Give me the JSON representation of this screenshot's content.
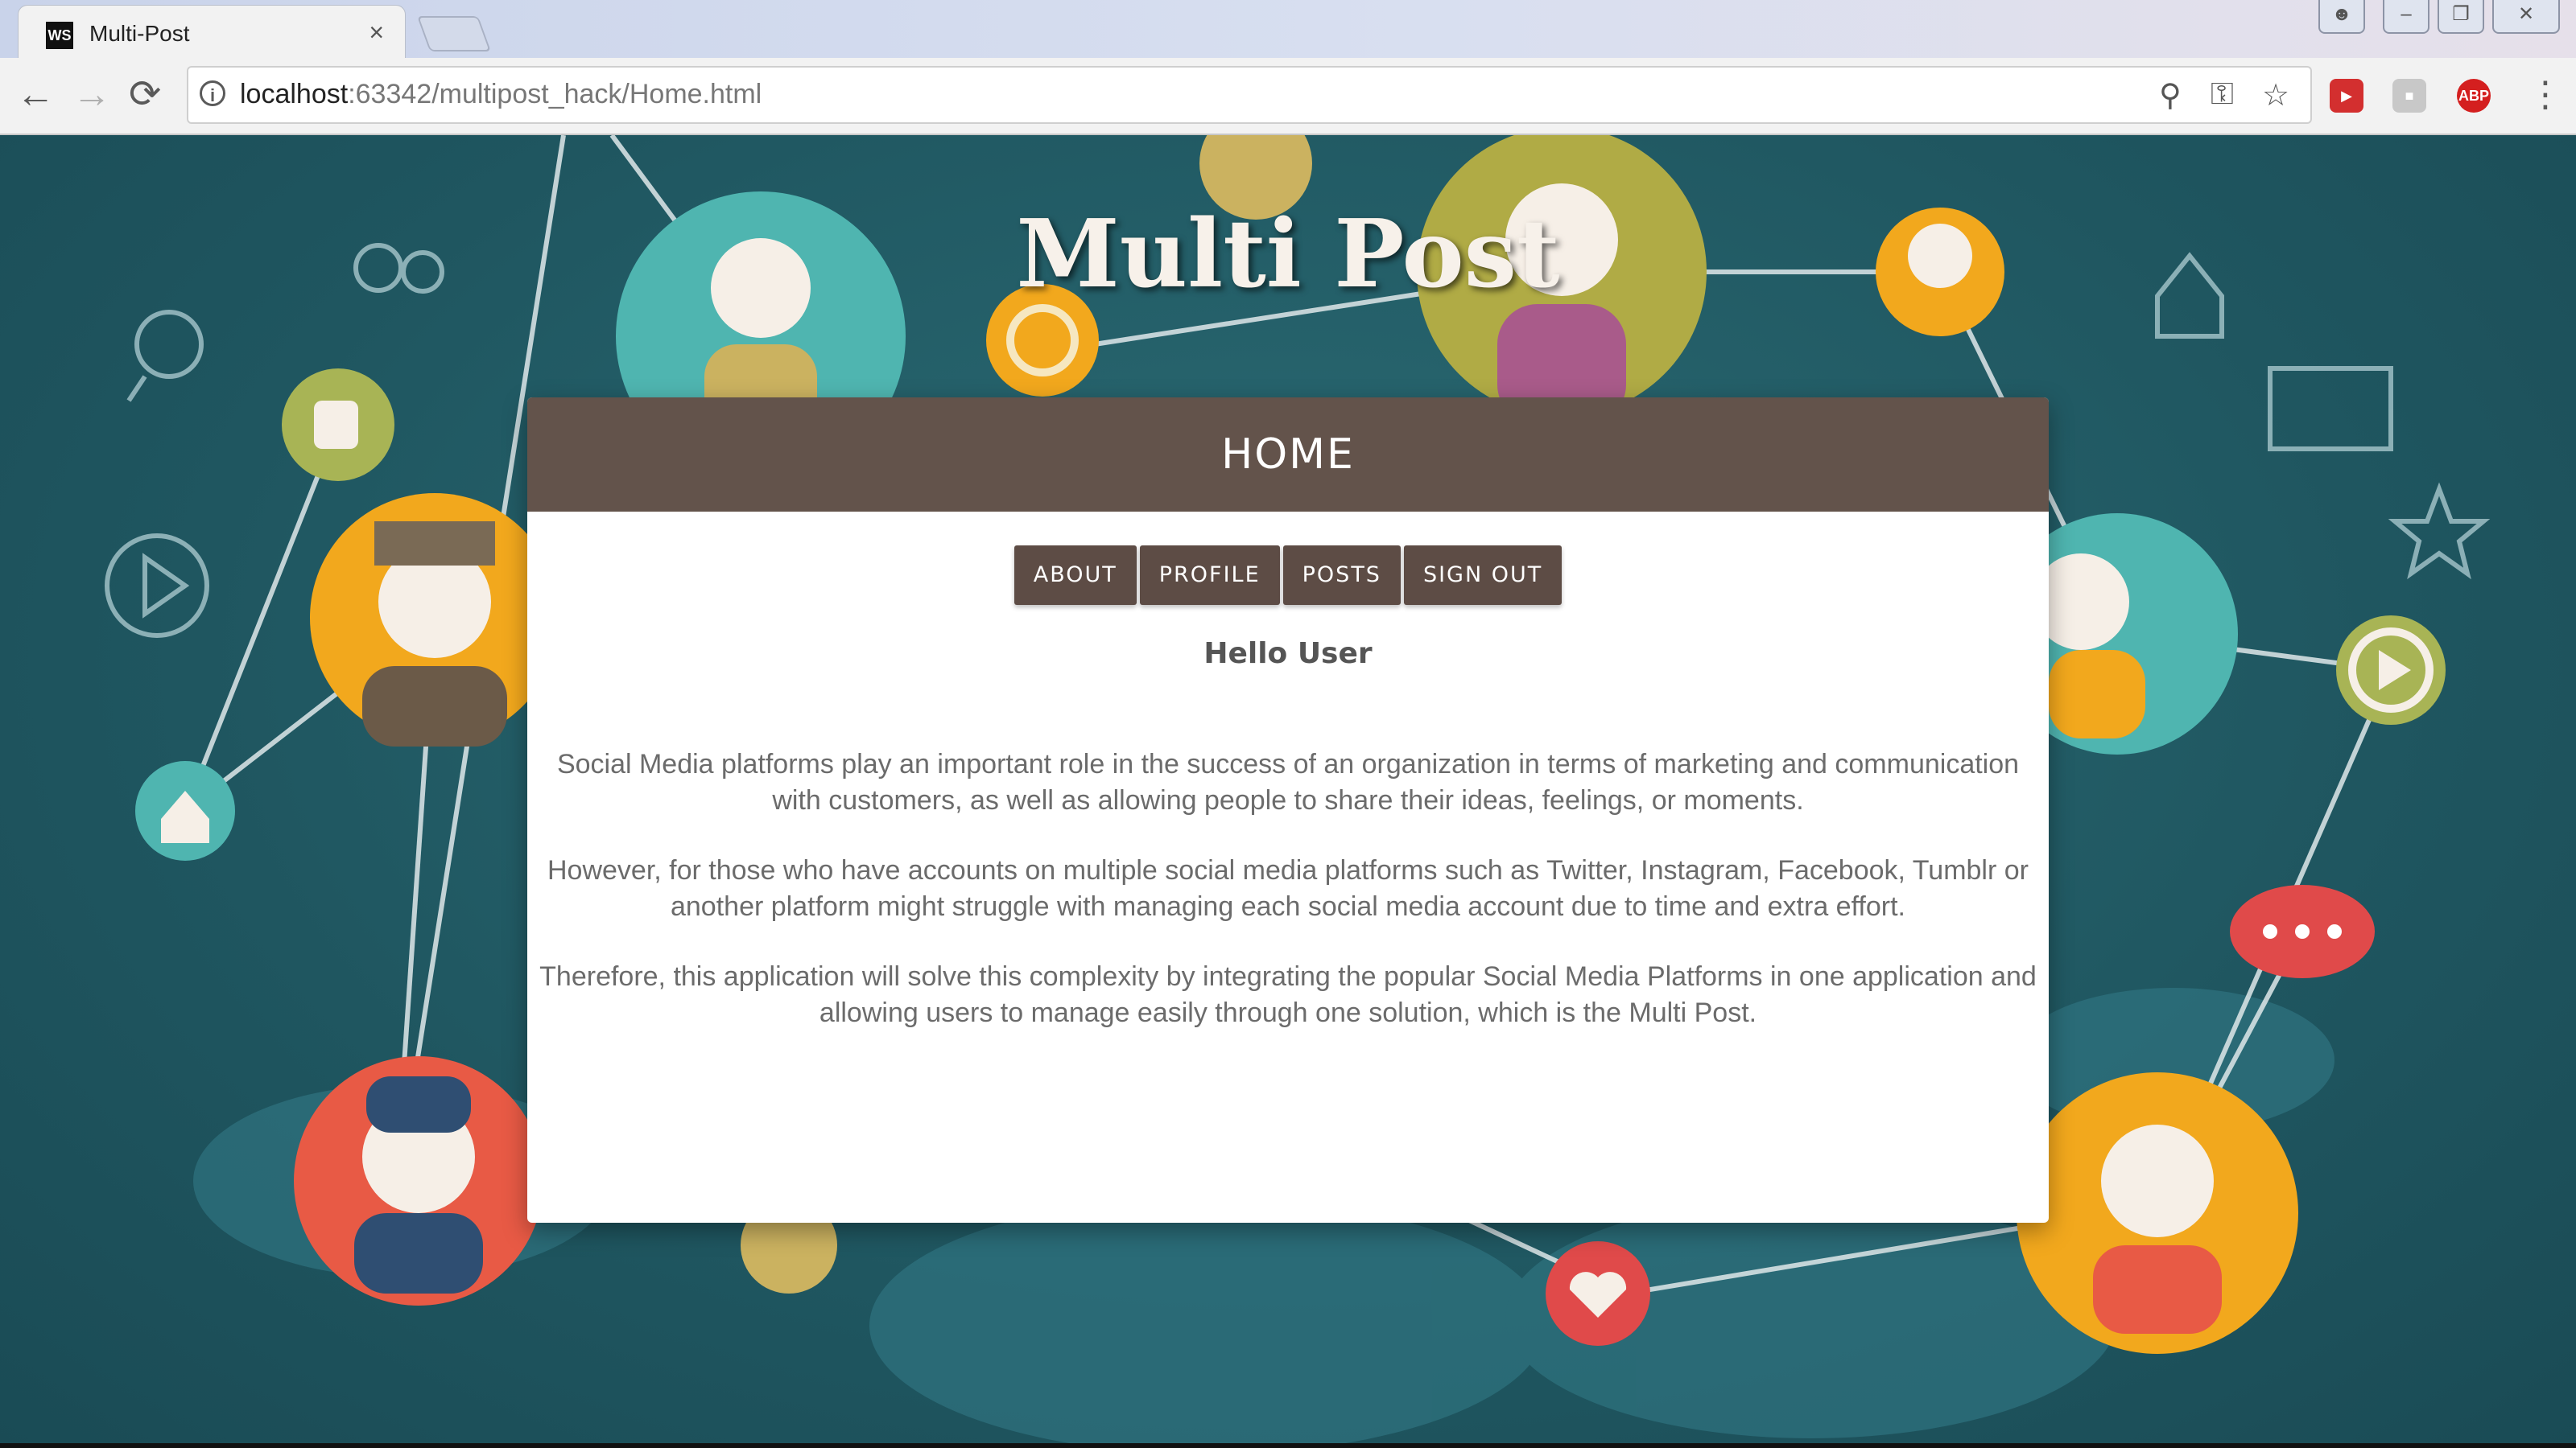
{
  "browser": {
    "tab_title": "Multi-Post",
    "tab_favicon": "WS",
    "tab_close": "×",
    "url_host": "localhost",
    "url_rest": ":63342/multipost_hack/Home.html",
    "back_icon": "←",
    "forward_icon": "→",
    "reload_icon": "⟳",
    "ext_abp": "ABP"
  },
  "page": {
    "site_title": "Multi Post",
    "card_title": "HOME",
    "nav_buttons": [
      "ABOUT",
      "PROFILE",
      "POSTS",
      "SIGN OUT"
    ],
    "greeting": "Hello User",
    "paragraphs": [
      "Social Media platforms play an important role in the success of an organization in terms of marketing and communication with customers, as well as allowing people to share their ideas, feelings, or moments.",
      "However, for those who have accounts on multiple social media platforms such as Twitter, Instagram, Facebook, Tumblr or another platform might struggle with managing each social media account due to time and extra effort.",
      "Therefore, this application will solve this complexity by integrating the popular Social Media Platforms in one application and allowing users to manage easily through one solution, which is the Multi Post."
    ]
  },
  "colors": {
    "header_brown": "#63534b",
    "button_brown": "#5d4c45",
    "background_teal": "#1f5660"
  }
}
